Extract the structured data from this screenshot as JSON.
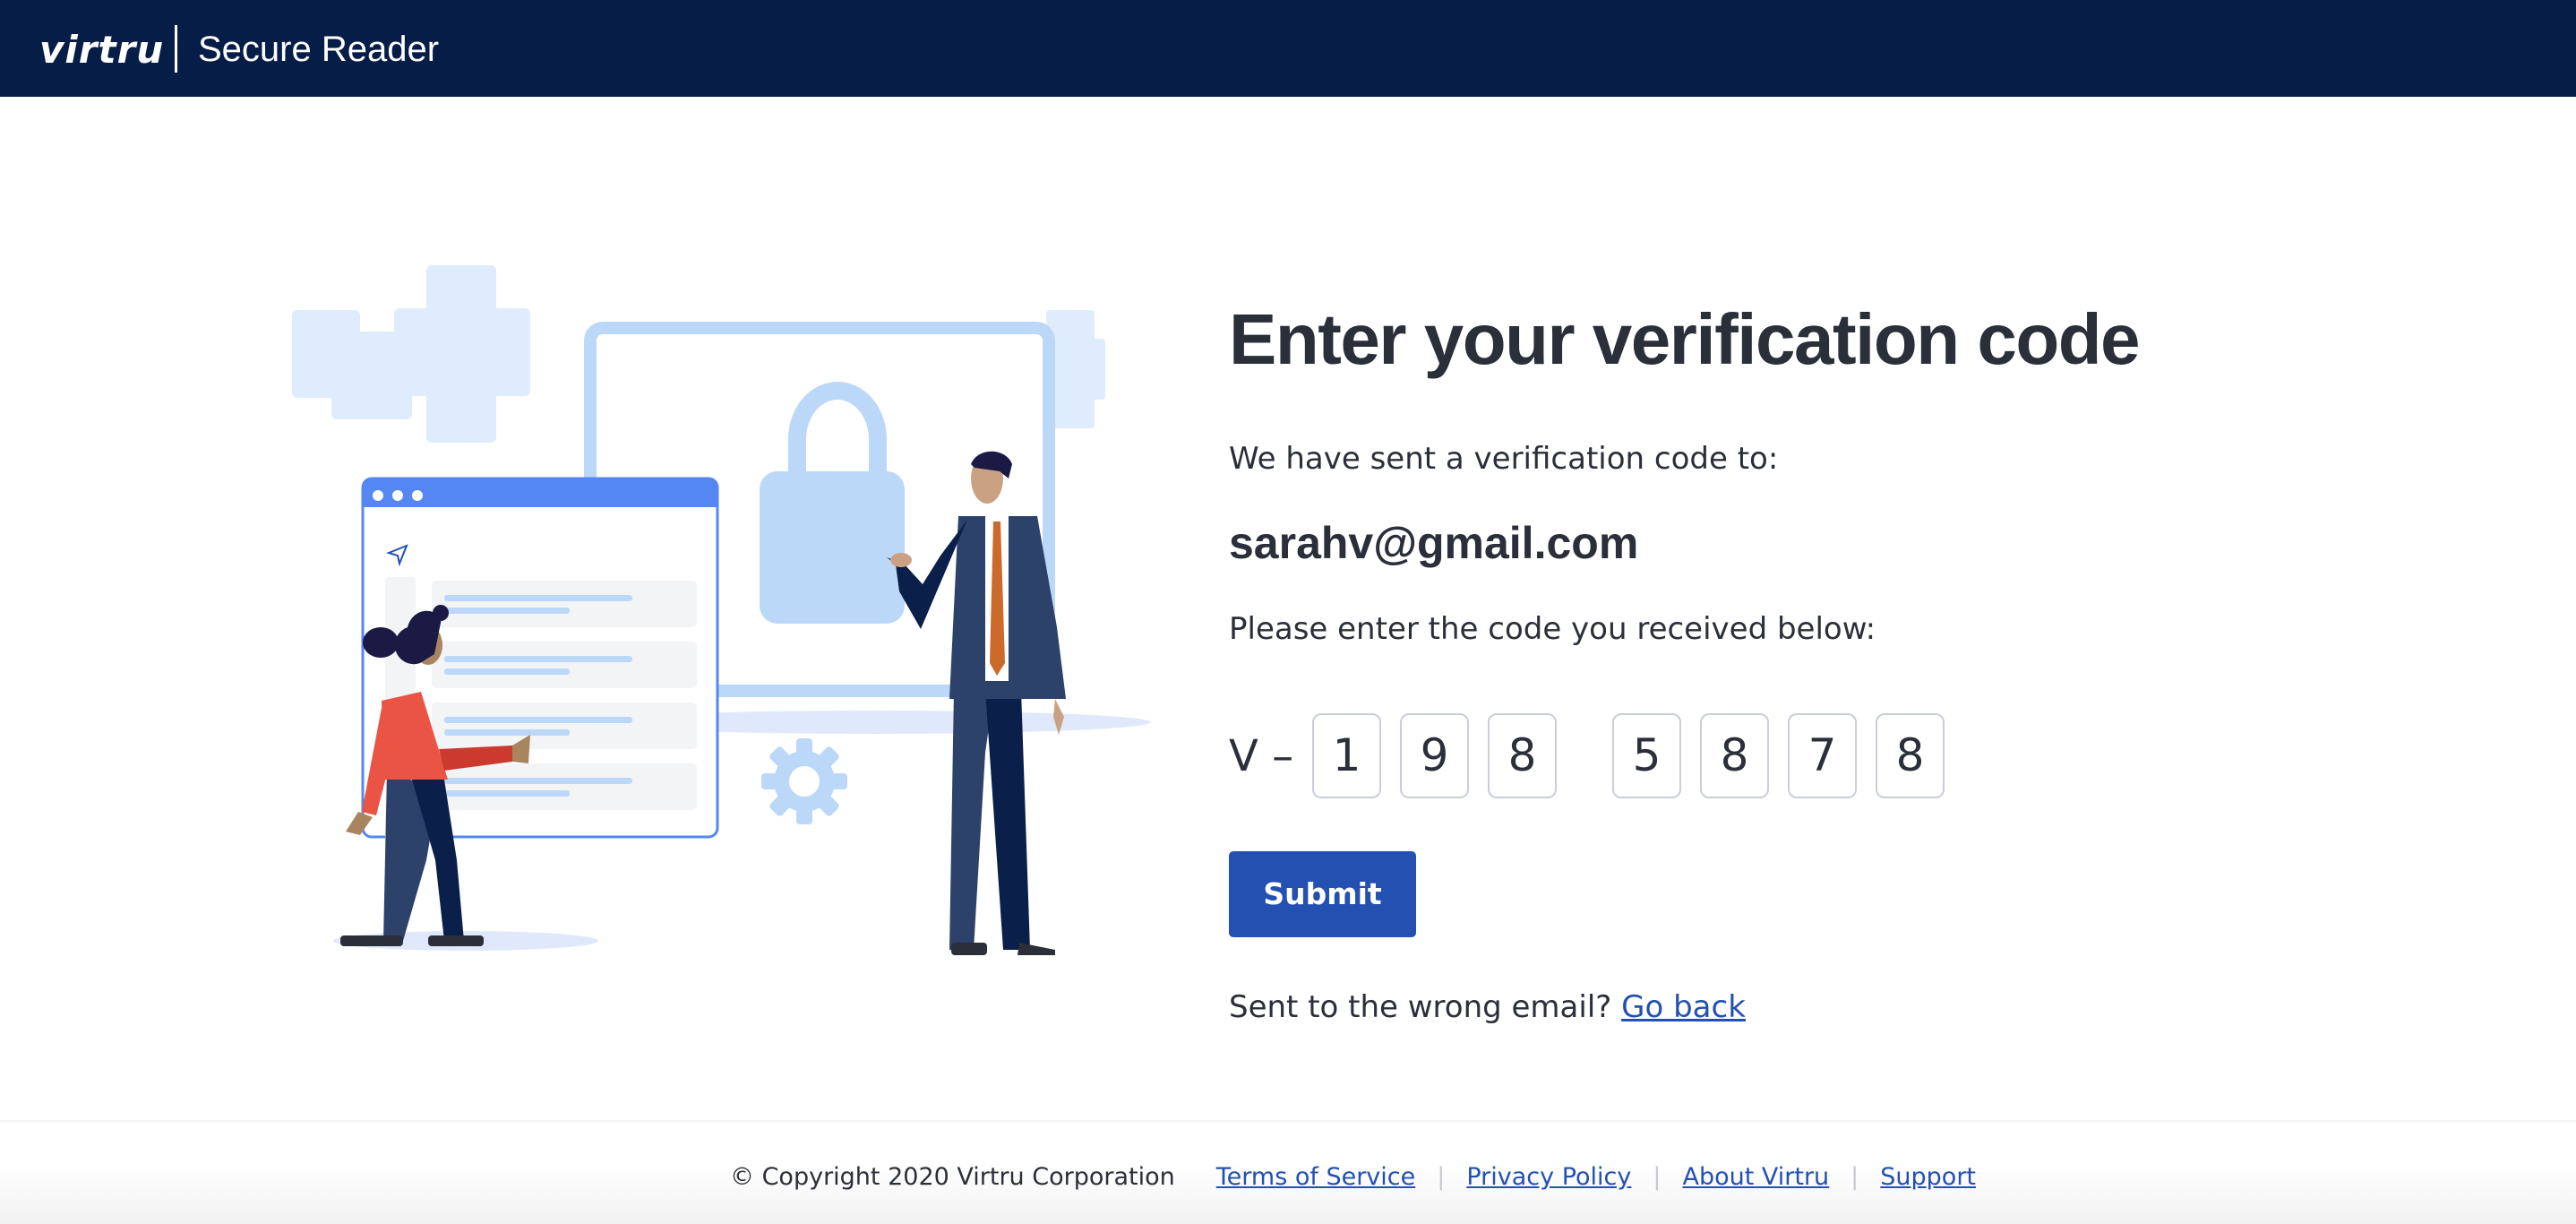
{
  "header": {
    "logo_text": "virtru",
    "app_title": "Secure Reader"
  },
  "main": {
    "title": "Enter your verification code",
    "sent_text": "We have sent a verification code to:",
    "email": "sarahv@gmail.com",
    "enter_text": "Please enter the code you received below:",
    "code_prefix": "V –",
    "code_digits": [
      "1",
      "9",
      "8",
      "5",
      "8",
      "7",
      "8"
    ],
    "submit_label": "Submit",
    "wrong_email_text": "Sent to the wrong email?",
    "go_back_label": "Go back"
  },
  "footer": {
    "copyright": "© Copyright 2020 Virtru Corporation",
    "links": [
      "Terms of Service",
      "Privacy Policy",
      "About Virtru",
      "Support"
    ],
    "separator": "|"
  },
  "colors": {
    "header_bg": "#061d47",
    "primary": "#2350b1",
    "text": "#2b2f3a",
    "input_border": "#c9ced8"
  },
  "illustration": {
    "description": "Two people with a browser window, padlock, and gear icons"
  }
}
